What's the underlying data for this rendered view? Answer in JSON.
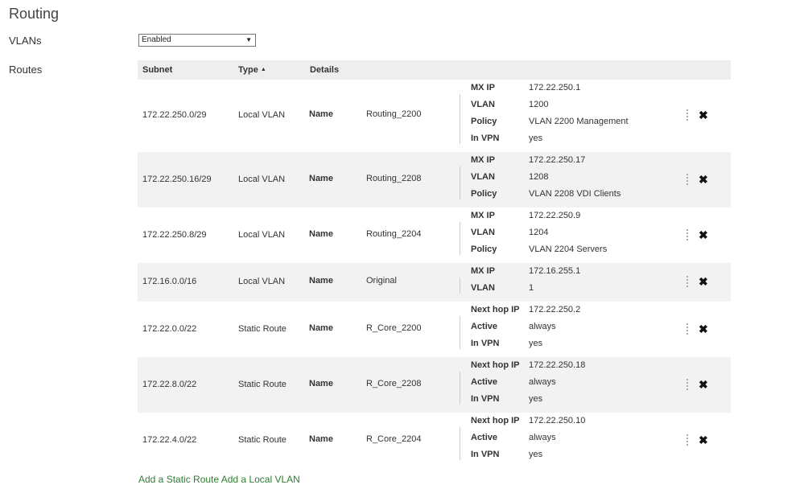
{
  "page": {
    "title": "Routing"
  },
  "vlans": {
    "label": "VLANs",
    "value": "Enabled"
  },
  "routes": {
    "label": "Routes",
    "headers": {
      "subnet": "Subnet",
      "type": "Type",
      "details": "Details",
      "sort_icon": "▲"
    },
    "rows": [
      {
        "subnet": "172.22.250.0/29",
        "type": "Local VLAN",
        "name_key": "Name",
        "name": "Routing_2200",
        "details": [
          {
            "k": "MX IP",
            "v": "172.22.250.1"
          },
          {
            "k": "VLAN",
            "v": "1200"
          },
          {
            "k": "Policy",
            "v": "VLAN 2200 Management"
          },
          {
            "k": "In VPN",
            "v": "yes"
          }
        ]
      },
      {
        "subnet": "172.22.250.16/29",
        "type": "Local VLAN",
        "name_key": "Name",
        "name": "Routing_2208",
        "details": [
          {
            "k": "MX IP",
            "v": "172.22.250.17"
          },
          {
            "k": "VLAN",
            "v": "1208"
          },
          {
            "k": "Policy",
            "v": "VLAN 2208 VDI Clients"
          }
        ]
      },
      {
        "subnet": "172.22.250.8/29",
        "type": "Local VLAN",
        "name_key": "Name",
        "name": "Routing_2204",
        "details": [
          {
            "k": "MX IP",
            "v": "172.22.250.9"
          },
          {
            "k": "VLAN",
            "v": "1204"
          },
          {
            "k": "Policy",
            "v": "VLAN 2204 Servers"
          }
        ]
      },
      {
        "subnet": "172.16.0.0/16",
        "type": "Local VLAN",
        "name_key": "Name",
        "name": "Original",
        "details": [
          {
            "k": "MX IP",
            "v": "172.16.255.1"
          },
          {
            "k": "VLAN",
            "v": "1"
          }
        ]
      },
      {
        "subnet": "172.22.0.0/22",
        "type": "Static Route",
        "name_key": "Name",
        "name": "R_Core_2200",
        "details": [
          {
            "k": "Next hop IP",
            "v": "172.22.250.2"
          },
          {
            "k": "Active",
            "v": "always"
          },
          {
            "k": "In VPN",
            "v": "yes"
          }
        ]
      },
      {
        "subnet": "172.22.8.0/22",
        "type": "Static Route",
        "name_key": "Name",
        "name": "R_Core_2208",
        "details": [
          {
            "k": "Next hop IP",
            "v": "172.22.250.18"
          },
          {
            "k": "Active",
            "v": "always"
          },
          {
            "k": "In VPN",
            "v": "yes"
          }
        ]
      },
      {
        "subnet": "172.22.4.0/22",
        "type": "Static Route",
        "name_key": "Name",
        "name": "R_Core_2204",
        "details": [
          {
            "k": "Next hop IP",
            "v": "172.22.250.10"
          },
          {
            "k": "Active",
            "v": "always"
          },
          {
            "k": "In VPN",
            "v": "yes"
          }
        ]
      }
    ],
    "delete_icon": "✖",
    "footer": "Add a Static Route   Add a Local VLAN"
  }
}
